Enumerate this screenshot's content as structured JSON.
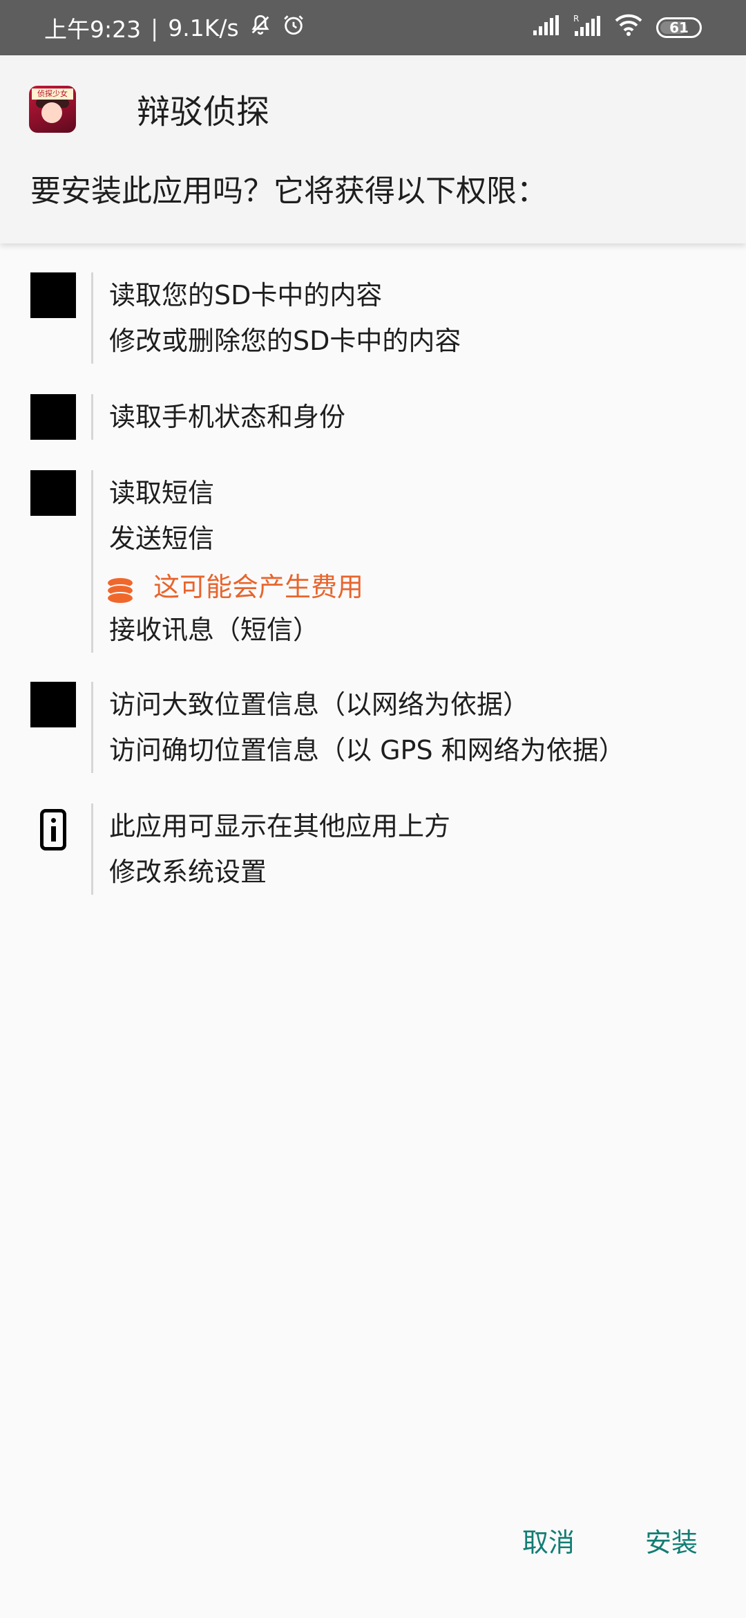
{
  "status_bar": {
    "time": "上午9:23",
    "network_speed": "9.1K/s",
    "battery_level": "61",
    "icons": [
      "mute-bell-icon",
      "alarm-icon",
      "signal-icon",
      "signal-roaming-icon",
      "wifi-icon",
      "battery-icon"
    ]
  },
  "header": {
    "app_name": "辩驳侦探",
    "app_icon_text": "侦探少女",
    "question": "要安装此应用吗？它将获得以下权限："
  },
  "permission_groups": [
    {
      "icon": "storage-icon",
      "items": [
        "读取您的SD卡中的内容",
        "修改或删除您的SD卡中的内容"
      ]
    },
    {
      "icon": "phone-icon",
      "items": [
        "读取手机状态和身份"
      ]
    },
    {
      "icon": "sms-icon",
      "items": [
        "读取短信",
        "发送短信"
      ],
      "warning": "这可能会产生费用",
      "items_after": [
        "接收讯息（短信）"
      ]
    },
    {
      "icon": "location-icon",
      "items": [
        "访问大致位置信息（以网络为依据）",
        "访问确切位置信息（以 GPS 和网络为依据）"
      ]
    },
    {
      "icon": "info-phone-icon",
      "items": [
        "此应用可显示在其他应用上方",
        "修改系统设置"
      ]
    }
  ],
  "footer": {
    "cancel_label": "取消",
    "install_label": "安装"
  },
  "colors": {
    "status_bar_bg": "#5e5e5e",
    "accent": "#127d74",
    "warning": "#e8642c"
  }
}
